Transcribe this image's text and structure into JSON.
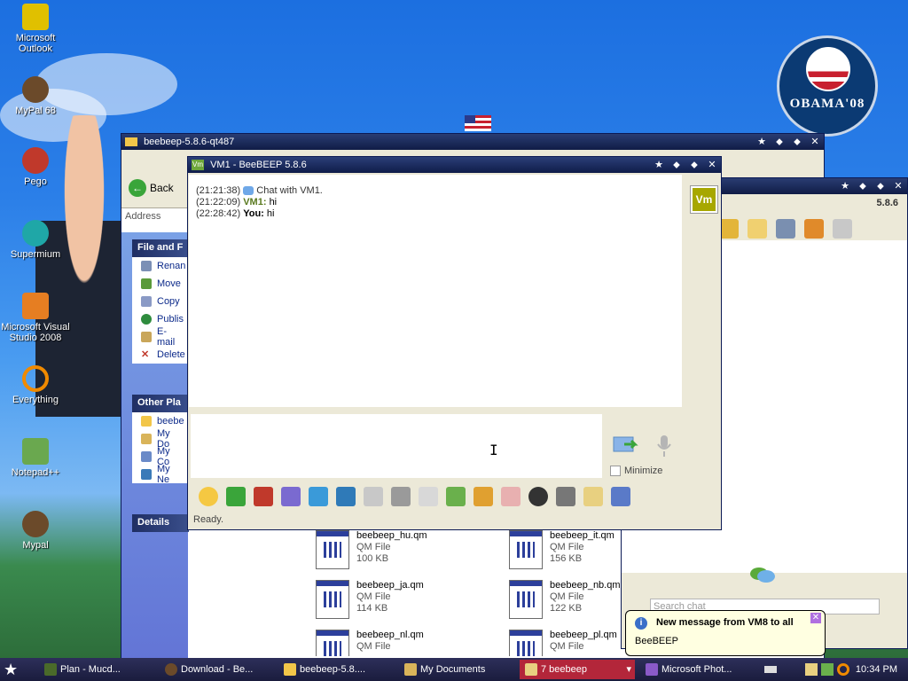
{
  "desktop": {
    "icons": [
      {
        "label": "Microsoft Outlook",
        "icon": "outlook-icon",
        "color": "#e0c000"
      },
      {
        "label": "MyPal 68",
        "icon": "raccoon-icon",
        "color": "#6b4a2a"
      },
      {
        "label": "Pego",
        "icon": "pego-icon",
        "color": "#c0392b"
      },
      {
        "label": "Supermium",
        "icon": "supermium-icon",
        "color": "#1fa7a7"
      },
      {
        "label": "Microsoft Visual Studio 2008",
        "icon": "visual-studio-icon",
        "color": "#e67e22"
      },
      {
        "label": "Everything",
        "icon": "everything-icon",
        "color": "#f08a00"
      },
      {
        "label": "Notepad++",
        "icon": "notepadpp-icon",
        "color": "#6aa84f"
      },
      {
        "label": "Mypal",
        "icon": "raccoon-icon",
        "color": "#6b4a2a"
      }
    ],
    "wallpaper_badge": "OBAMA'08"
  },
  "explorer": {
    "title": "beebeep-5.8.6-qt487",
    "back_label": "Back",
    "address_label": "Address",
    "tasks_header": "File and F",
    "tasks": [
      "Renan",
      "Move",
      "Copy",
      "Publis",
      "E-mail",
      "Delete"
    ],
    "other_header": "Other Pla",
    "other": [
      "beebe",
      "My Do",
      "My Co",
      "My Ne"
    ],
    "details_header": "Details",
    "files": [
      {
        "name": "beebeep_hu.qm",
        "type": "QM File",
        "size": "100 KB"
      },
      {
        "name": "beebeep_it.qm",
        "type": "QM File",
        "size": "156 KB"
      },
      {
        "name": "beebeep_ja.qm",
        "type": "QM File",
        "size": "114 KB"
      },
      {
        "name": "beebeep_nb.qm",
        "type": "QM File",
        "size": "122 KB"
      },
      {
        "name": "beebeep_nl.qm",
        "type": "QM File",
        "size": ""
      },
      {
        "name": "beebeep_pl.qm",
        "type": "QM File",
        "size": ""
      }
    ]
  },
  "beebeep_main": {
    "version": "5.8.6",
    "search_placeholder": "Search chat"
  },
  "chat": {
    "title": "VM1 - BeeBEEP 5.8.6",
    "title_icon": "Vm",
    "avatar": "Vm",
    "messages": [
      {
        "time": "(21:21:38)",
        "sender": "",
        "text": "Chat with VM1."
      },
      {
        "time": "(21:22:09)",
        "sender": "VM1:",
        "text": "hi"
      },
      {
        "time": "(22:28:42)",
        "sender": "You:",
        "text": "hi"
      }
    ],
    "minimize_label": "Minimize",
    "status": "Ready."
  },
  "notification": {
    "title": "New message from VM8 to all",
    "body": "BeeBEEP"
  },
  "taskbar": {
    "items": [
      {
        "label": "Plan - Mucd...",
        "active": false
      },
      {
        "label": "Download - Be...",
        "active": false
      },
      {
        "label": "beebeep-5.8....",
        "active": false
      },
      {
        "label": "My Documents",
        "active": false
      },
      {
        "label": "7 beebeep",
        "active": true
      },
      {
        "label": "Microsoft Phot...",
        "active": false
      }
    ],
    "clock": "10:34 PM"
  },
  "colors": {
    "titlebar": "#16234f",
    "taskbar_active": "#b3263a",
    "avatar_bg": "#a7a700"
  }
}
